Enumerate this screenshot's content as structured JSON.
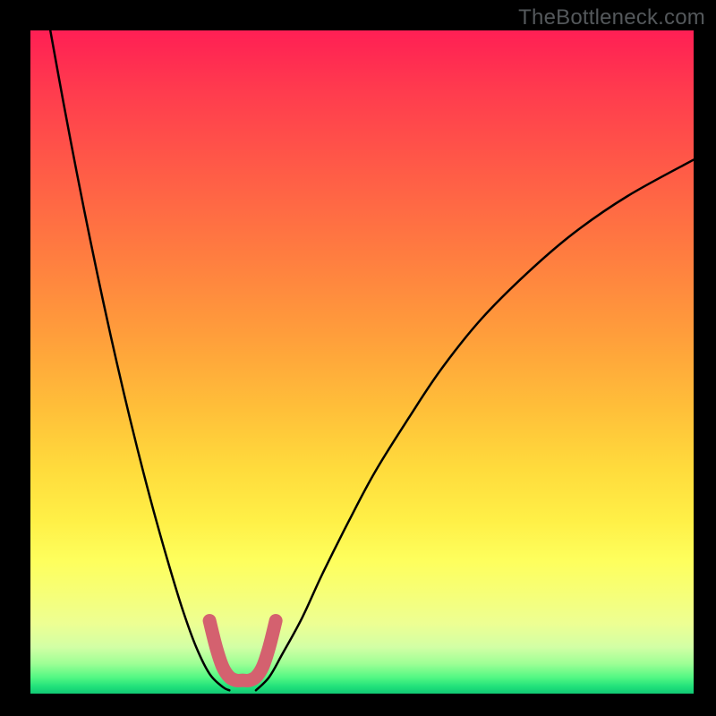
{
  "watermark": "TheBottleneck.com",
  "chart_data": {
    "type": "line",
    "title": "",
    "xlabel": "",
    "ylabel": "",
    "xlim": [
      0,
      100
    ],
    "ylim": [
      0,
      100
    ],
    "grid": false,
    "legend": false,
    "series": [
      {
        "name": "curve-left",
        "x": [
          3,
          5,
          7,
          9,
          11,
          13,
          15,
          17,
          19,
          21,
          23,
          25,
          27,
          29,
          30
        ],
        "y": [
          100,
          89,
          78.5,
          68.5,
          59,
          50,
          41.5,
          33.5,
          26,
          19,
          12.5,
          7,
          3,
          1,
          0.5
        ]
      },
      {
        "name": "curve-right",
        "x": [
          34,
          36,
          38,
          41,
          44,
          48,
          52,
          57,
          62,
          68,
          75,
          82,
          90,
          100
        ],
        "y": [
          0.5,
          2.5,
          6,
          11.5,
          18,
          26,
          33.5,
          41.5,
          49,
          56.5,
          63.5,
          69.5,
          75,
          80.5
        ]
      },
      {
        "name": "highlight-band",
        "x": [
          27,
          28,
          29,
          30,
          31,
          32,
          33,
          34,
          35,
          36,
          37
        ],
        "y": [
          11,
          7,
          4,
          2.5,
          2,
          2,
          2,
          2.5,
          4,
          7,
          11
        ]
      }
    ],
    "background_gradient": {
      "stops": [
        {
          "offset": 0.0,
          "color": "#ff1f54"
        },
        {
          "offset": 0.09,
          "color": "#ff3b4e"
        },
        {
          "offset": 0.21,
          "color": "#ff5b47"
        },
        {
          "offset": 0.34,
          "color": "#ff7d40"
        },
        {
          "offset": 0.46,
          "color": "#ff9e3b"
        },
        {
          "offset": 0.57,
          "color": "#ffbf39"
        },
        {
          "offset": 0.66,
          "color": "#ffdb3c"
        },
        {
          "offset": 0.74,
          "color": "#fff047"
        },
        {
          "offset": 0.8,
          "color": "#feff5d"
        },
        {
          "offset": 0.85,
          "color": "#f6ff78"
        },
        {
          "offset": 0.895,
          "color": "#edff93"
        },
        {
          "offset": 0.93,
          "color": "#d2ffa5"
        },
        {
          "offset": 0.955,
          "color": "#9dff95"
        },
        {
          "offset": 0.975,
          "color": "#55f884"
        },
        {
          "offset": 0.99,
          "color": "#1fe07a"
        },
        {
          "offset": 1.0,
          "color": "#12c874"
        }
      ]
    },
    "styles": {
      "curve_stroke": "#000000",
      "curve_width": 2.5,
      "highlight_stroke": "#d4616f",
      "highlight_width": 15
    }
  }
}
